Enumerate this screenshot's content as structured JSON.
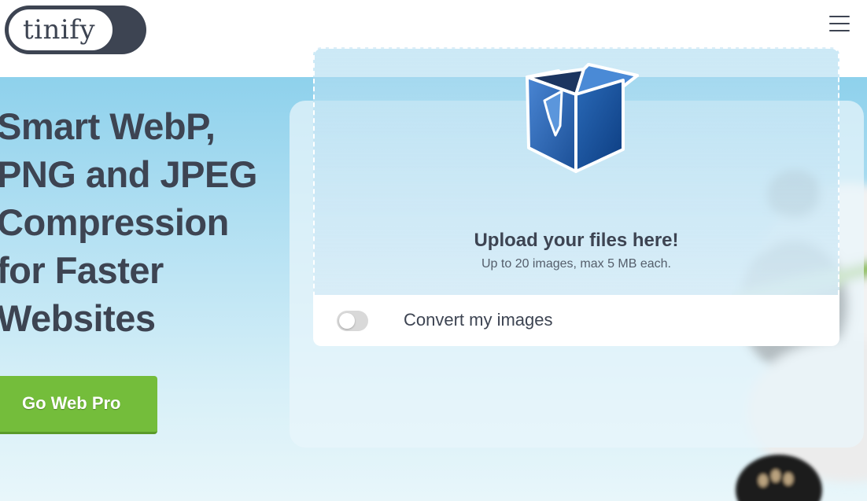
{
  "header": {
    "logo_text": "tinify",
    "menu_icon": "hamburger-menu-icon"
  },
  "hero": {
    "title_lines": [
      "Smart WebP,",
      "PNG and JPEG",
      "Compression",
      "for Faster",
      "Websites"
    ],
    "cta_label": "Go Web Pro"
  },
  "upload": {
    "box_icon": "open-box-icon",
    "title": "Upload your files here!",
    "subtitle": "Up to 20 images, max 5 MB each.",
    "convert_label": "Convert my images",
    "convert_enabled": false
  },
  "colors": {
    "text_dark": "#3d4452",
    "cta_green": "#74bd3b",
    "hero_sky": "#8ed1ec"
  }
}
